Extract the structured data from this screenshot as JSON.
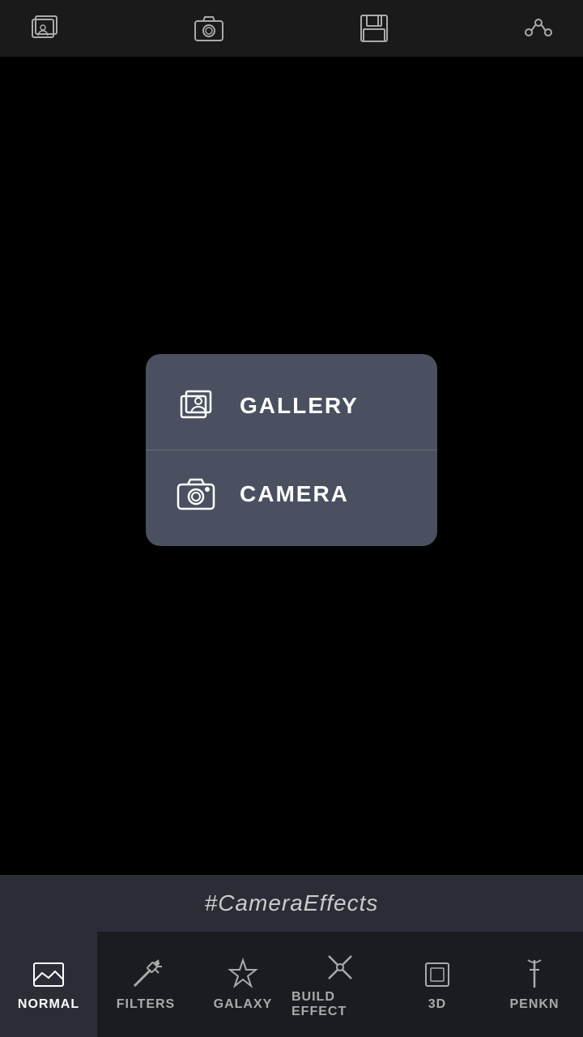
{
  "toolbar": {
    "gallery_icon": "gallery-icon",
    "camera_icon": "camera-icon",
    "save_icon": "save-icon",
    "share_icon": "share-icon"
  },
  "popup": {
    "gallery_label": "GALLERY",
    "camera_label": "CAMERA"
  },
  "hashtag": {
    "text": "#CameraEffects"
  },
  "tabs": [
    {
      "id": "normal",
      "label": "NORMAL"
    },
    {
      "id": "filters",
      "label": "FILTERS"
    },
    {
      "id": "galaxy",
      "label": "GALAXY"
    },
    {
      "id": "build_effect",
      "label": "BUILD EFFECT"
    },
    {
      "id": "3d",
      "label": "3D"
    },
    {
      "id": "penkn",
      "label": "PENKN"
    }
  ]
}
